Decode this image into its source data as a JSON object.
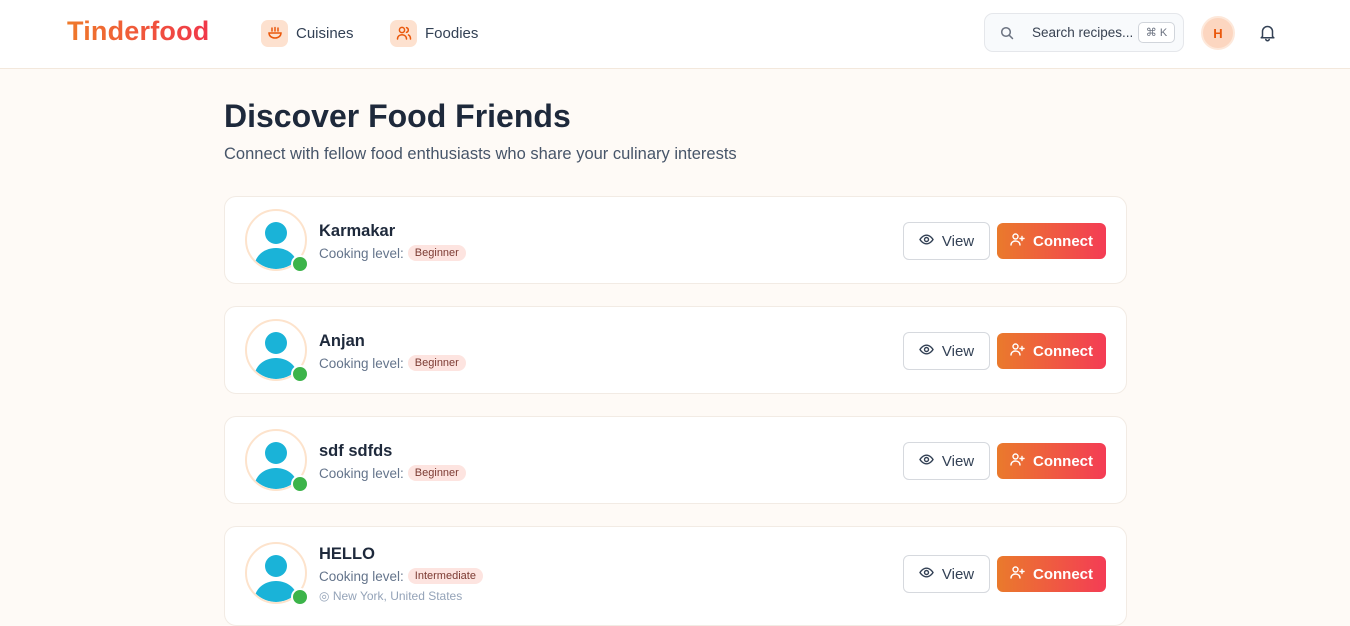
{
  "header": {
    "logo": "Tinderfood",
    "nav": [
      {
        "label": "Cuisines",
        "icon": "bowl-icon"
      },
      {
        "label": "Foodies",
        "icon": "users-icon"
      }
    ],
    "search": {
      "placeholder": "Search recipes...",
      "shortcut": "⌘ K"
    },
    "user_initial": "H"
  },
  "main": {
    "title": "Discover Food Friends",
    "subtitle": "Connect with fellow food enthusiasts who share your culinary interests",
    "level_label": "Cooking level:",
    "view_label": "View",
    "connect_label": "Connect",
    "users": [
      {
        "name": "Karmakar",
        "level": "Beginner"
      },
      {
        "name": "Anjan",
        "level": "Beginner"
      },
      {
        "name": "sdf sdfds",
        "level": "Beginner"
      },
      {
        "name": "HELLO",
        "level": "Intermediate",
        "location": "New York, United States"
      }
    ]
  },
  "colors": {
    "brand_start": "#ef7a2a",
    "brand_end": "#f0374a",
    "avatar_person": "#1ab3d8",
    "online": "#3cb44a",
    "badge_bg": "#fde4e0"
  }
}
